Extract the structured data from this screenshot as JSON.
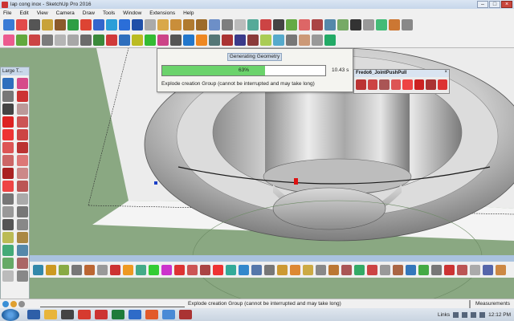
{
  "window": {
    "title": "lap cong inox - SketchUp Pro 2016",
    "buttons": {
      "minimize": "–",
      "maximize": "□",
      "close": "×"
    }
  },
  "menu": [
    "File",
    "Edit",
    "View",
    "Camera",
    "Draw",
    "Tools",
    "Window",
    "Extensions",
    "Help"
  ],
  "large_tool_set": {
    "title": "Large T..."
  },
  "progress": {
    "caption": "Generating Geometry",
    "percent_label": "63%",
    "percent": 63,
    "elapsed": "10.43 s",
    "message": "Explode creation Group (cannot be interrupted and may take long)"
  },
  "fredo_toolbar": {
    "title": "Fredo6_JointPushPull",
    "close": "×"
  },
  "status": {
    "message": "Explode creation Group (cannot be interrupted and may take long)",
    "measurements_label": "Measurements"
  },
  "taskbar": {
    "links": "Links",
    "time": "12:12 PM"
  },
  "colors": {
    "ground": "#8aa882",
    "progress_fill": "#6bd36b",
    "selection_red": "#d11"
  }
}
